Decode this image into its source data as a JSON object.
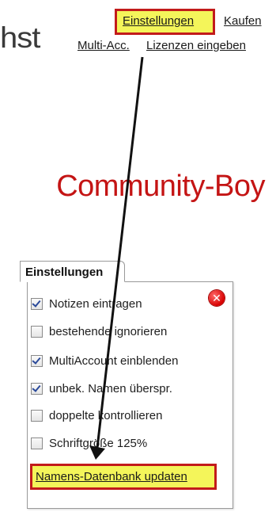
{
  "header": {
    "title_fragment": "hst",
    "links": {
      "settings": "Einstellungen",
      "buy": "Kaufen",
      "multi_acc": "Multi-Acc.",
      "licenses": "Lizenzen eingeben"
    }
  },
  "brand": {
    "name": "Community-Boy",
    "color": "#c41414"
  },
  "settings_panel": {
    "tab_label": "Einstellungen",
    "close_icon": "close-icon",
    "options": [
      {
        "label": "Notizen eintragen",
        "checked": true
      },
      {
        "label": "bestehende ignorieren",
        "checked": false
      },
      {
        "label": "MultiAccount einblenden",
        "checked": true
      },
      {
        "label": "unbek. Namen überspr.",
        "checked": true
      },
      {
        "label": "doppelte kontrollieren",
        "checked": false
      },
      {
        "label": "Schriftgröße 125%",
        "checked": false
      }
    ],
    "update_link": "Namens-Datenbank updaten"
  },
  "highlight": {
    "fill": "#f4f55a",
    "border": "#c21b1b"
  }
}
